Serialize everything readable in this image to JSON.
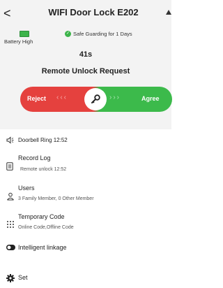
{
  "header": {
    "back_glyph": "<",
    "title": "WIFI Door Lock E202",
    "battery": {
      "label": "Battery High",
      "color": "#3cb44a"
    },
    "status": {
      "label": "Safe Guarding for 1 Days",
      "color": "#3cb44a"
    },
    "countdown": "41s",
    "request_title": "Remote Unlock Request"
  },
  "slider": {
    "reject_label": "Reject",
    "agree_label": "Agree",
    "left_chevrons": "‹‹‹",
    "right_chevrons": "›››",
    "reject_color": "#e5413e",
    "agree_color": "#3cba4b"
  },
  "menu": {
    "doorbell": {
      "label": "Doorbell Ring 12:52",
      "icon": "speaker-icon"
    },
    "record_log": {
      "label": "Record Log",
      "sub": "Remote unlock 12:52",
      "icon": "document-icon"
    },
    "users": {
      "label": "Users",
      "sub": "3 Family Member, 0 Other Member",
      "icon": "users-icon"
    },
    "temp_code": {
      "label": "Temporary Code",
      "sub": "Online Code,Offline Code",
      "icon": "keypad-icon"
    },
    "linkage": {
      "label": "Intelligent linkage",
      "icon": "toggle-icon"
    },
    "settings": {
      "label": "Set",
      "icon": "gear-icon"
    }
  }
}
